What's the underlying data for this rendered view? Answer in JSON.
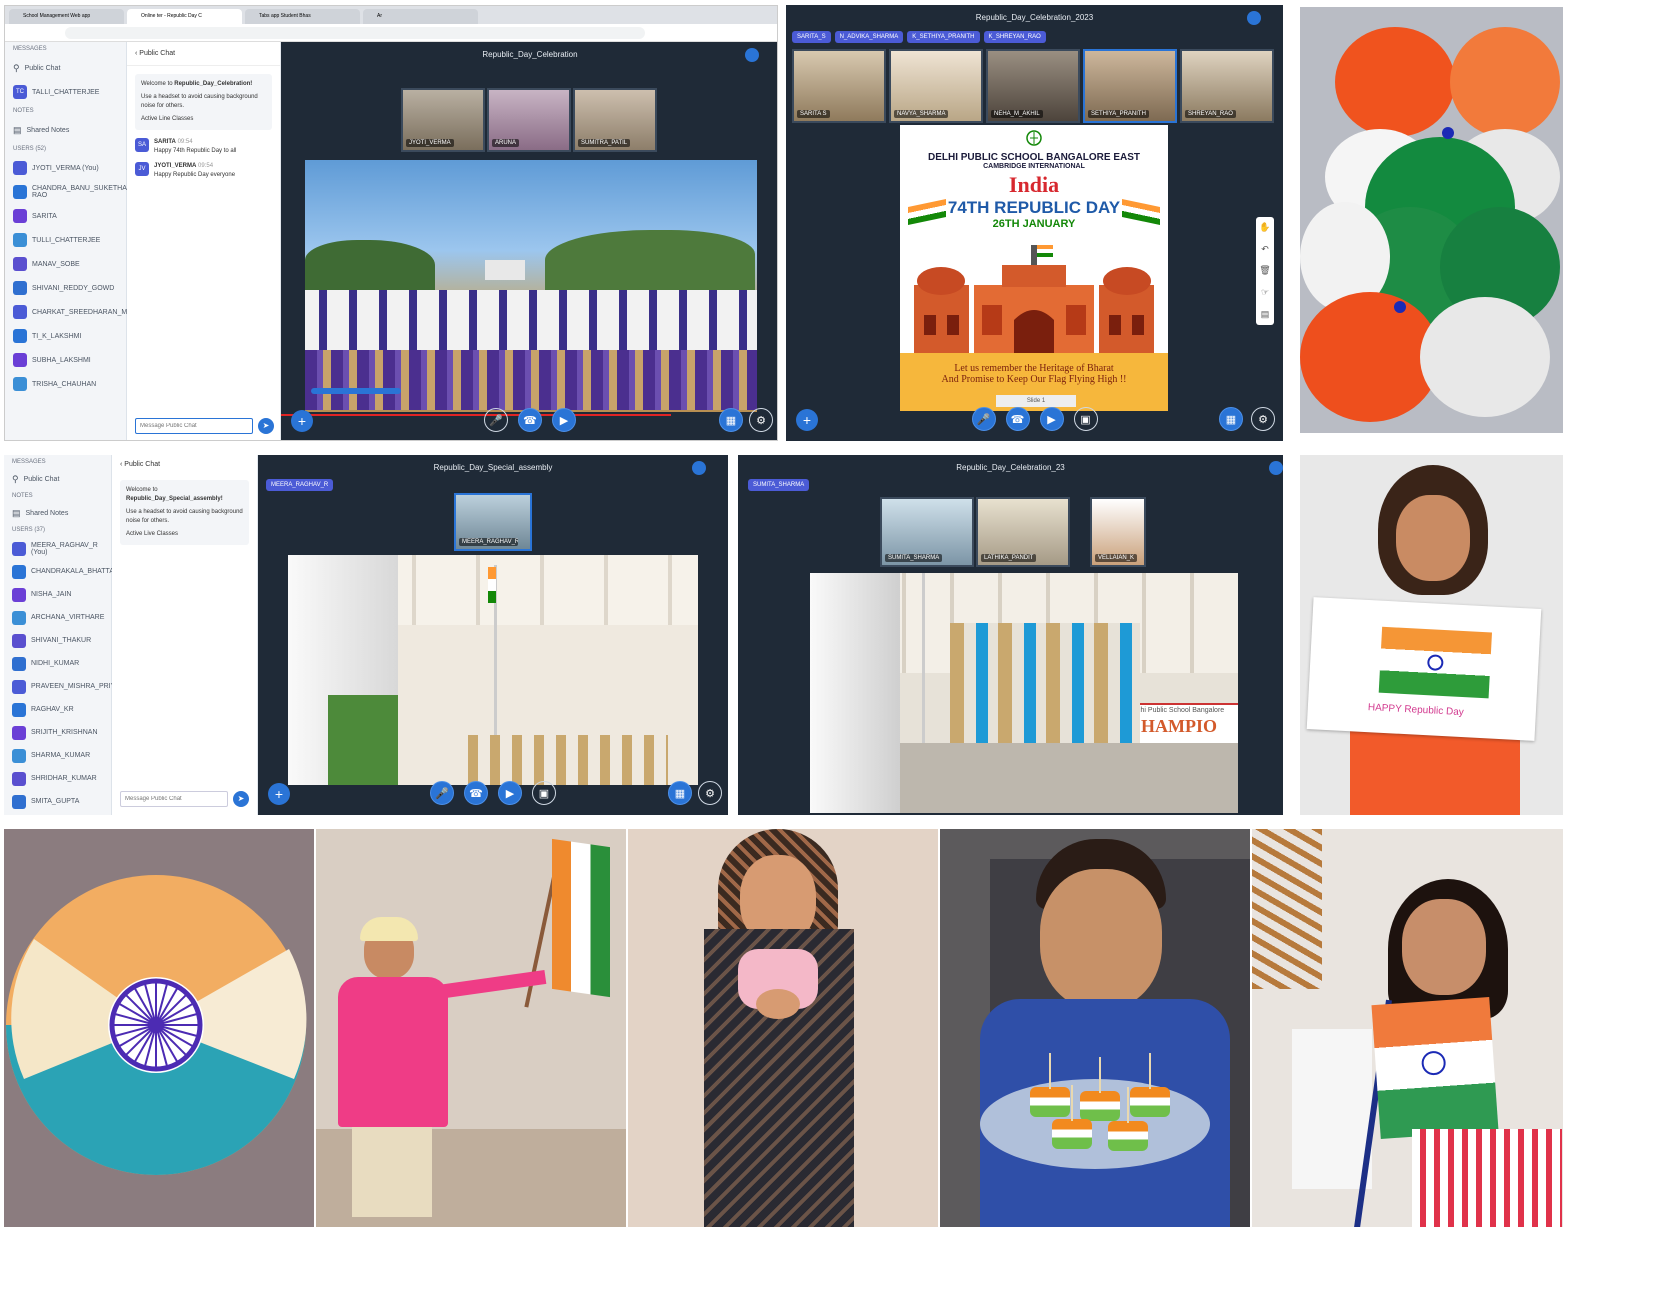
{
  "panel1": {
    "browser_tabs": [
      "School Management Web app",
      "Online ter - Republic Day C",
      "Tabs app Student Bhas",
      "Ar"
    ],
    "session_title": "Republic_Day_Celebration",
    "sidebar": {
      "messages_label": "MESSAGES",
      "public_chat": "Public Chat",
      "private_chat_user": "TALLI_CHATTERJEE",
      "notes_label": "NOTES",
      "shared_notes": "Shared Notes",
      "users_label": "USERS (52)",
      "users": [
        "JYOTI_VERMA (You)",
        "CHANDRA_BANU_SUKETHA RAO",
        "SARITA",
        "TULLI_CHATTERJEE",
        "MANAV_SOBE",
        "SHIVANI_REDDY_GOWD",
        "CHARKAT_SREEDHARAN_M",
        "TI_K_LAKSHMI",
        "SUBHA_LAKSHMI",
        "TRISHA_CHAUHAN"
      ]
    },
    "chat": {
      "header": "Public Chat",
      "welcome_prefix": "Welcome to",
      "welcome_room": "Republic_Day_Celebration!",
      "tip": "Use a headset to avoid causing background noise for others.",
      "active_line": "Active Line Classes",
      "messages": [
        {
          "user": "SARITA",
          "time": "09:54",
          "text": "Happy 74th Republic Day to all"
        },
        {
          "user": "JYOTI_VERMA",
          "time": "09:54",
          "text": "Happy Republic Day everyone"
        }
      ],
      "input_placeholder": "Message Public Chat"
    },
    "participants": [
      "JYOTI_VERMA",
      "ARUNA",
      "SUMITRA_PATIL"
    ]
  },
  "panel2": {
    "session_title": "Republic_Day_Celebration_2023",
    "tags": [
      "SARITA_S",
      "N_ADVIKA_SHARMA",
      "K_SETHIYA_PRANITH",
      "K_SHREYAN_RAO"
    ],
    "participants": [
      "SARITA S",
      "NAVYA_SHARMA",
      "NEHA_M_AKHIL",
      "SETHIYA_PRANITH",
      "SHREYAN_RAO"
    ],
    "poster": {
      "school": "DELHI PUBLIC SCHOOL BANGALORE EAST",
      "affiliation": "CAMBRIDGE INTERNATIONAL",
      "country": "India",
      "event": "74TH REPUBLIC DAY",
      "date": "26TH JANUARY",
      "line1": "Let us remember the Heritage of Bharat",
      "line2": "And Promise to Keep Our Flag Flying High !!",
      "slide": "Slide 1"
    }
  },
  "panel3": {
    "session_title": "Republic_Day_Special_assembly",
    "tag": "MEERA_RAGHAV_R",
    "sidebar": {
      "messages_label": "MESSAGES",
      "public_chat": "Public Chat",
      "notes_label": "NOTES",
      "shared_notes": "Shared Notes",
      "users_label": "USERS (37)",
      "users": [
        "MEERA_RAGHAV_R (You)",
        "CHANDRAKALA_BHATTACHARJEE",
        "NISHA_JAIN",
        "ARCHANA_VIRTHARE",
        "SHIVANI_THAKUR",
        "NIDHI_KUMAR",
        "PRAVEEN_MISHRA_PRIYA_RAO",
        "RAGHAV_KR",
        "SRIJITH_KRISHNAN",
        "SHARMA_KUMAR",
        "SHRIDHAR_KUMAR",
        "SMITA_GUPTA"
      ]
    },
    "chat": {
      "header": "Public Chat",
      "welcome_prefix": "Welcome to",
      "welcome_room": "Republic_Day_Special_assembly!",
      "tip": "Use a headset to avoid causing background noise for others.",
      "active_line": "Active Live Classes",
      "input_placeholder": "Message Public Chat"
    },
    "presenter": "MEERA_RAGHAV_R"
  },
  "panel4": {
    "session_title": "Republic_Day_Celebration_23",
    "tag": "SUMITA_SHARMA",
    "participants": [
      "SUMITA_SHARMA",
      "LATHIKA_PANDIT",
      "VELLAIAN_K"
    ],
    "banner": "Delhi Public School Bangalore",
    "stage_text": "CHAMPIO"
  },
  "drawing_text": "HAPPY Republic Day",
  "colors": {
    "saffron": "#ff9933",
    "green": "#138808",
    "navy": "#000080",
    "bbb_dark": "#1f2a37",
    "bbb_blue": "#2a74d6"
  }
}
